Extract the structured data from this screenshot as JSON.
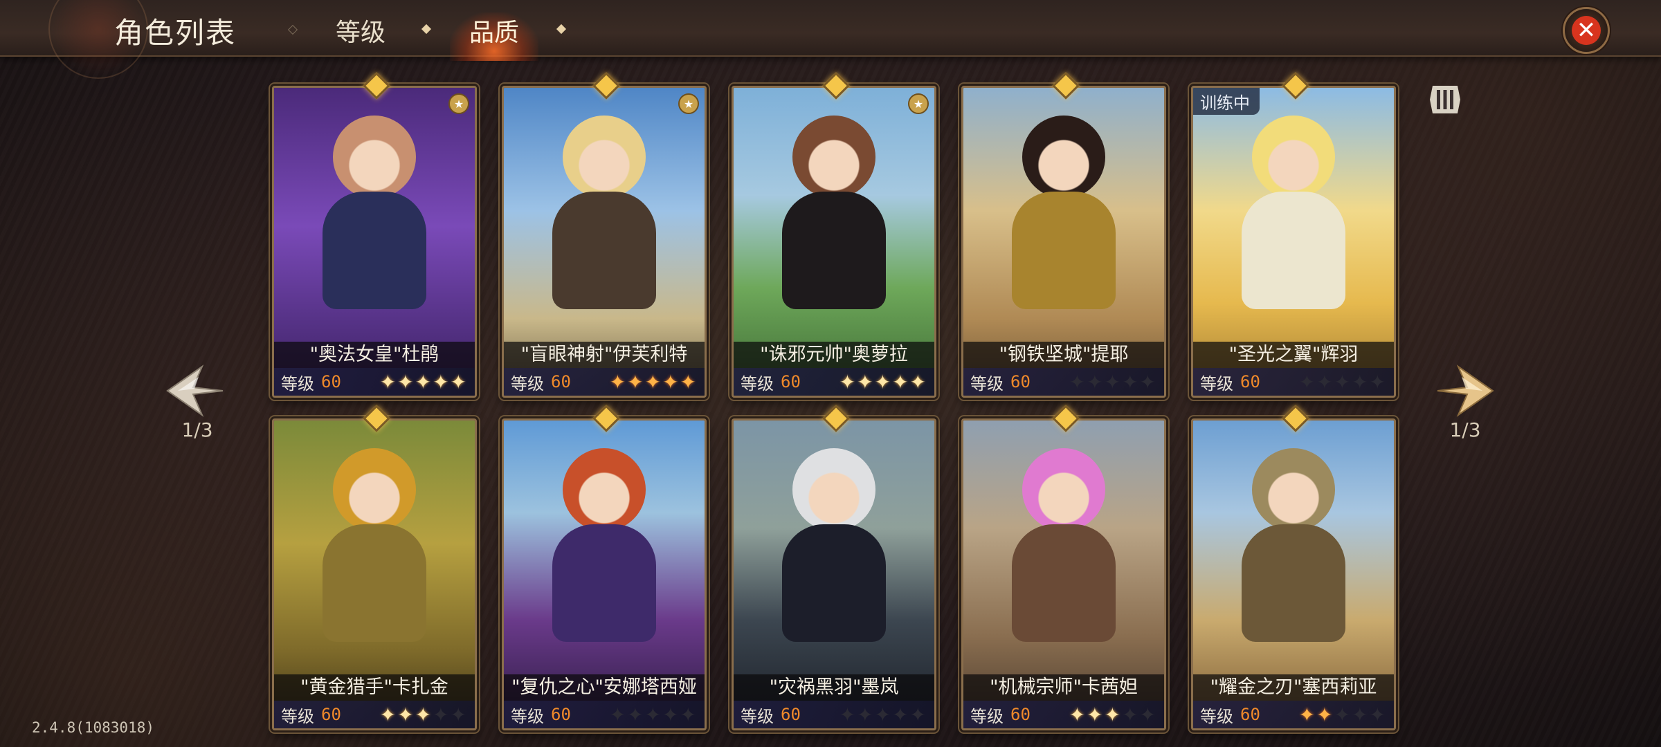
{
  "header": {
    "title": "角色列表",
    "tabs": [
      {
        "label": "等级",
        "active": false
      },
      {
        "label": "品质",
        "active": true
      }
    ],
    "close_icon": "close-icon"
  },
  "pagination": {
    "left": "1/3",
    "right": "1/3"
  },
  "level_label": "等级",
  "training_label": "训练中",
  "version": "2.4.8(1083018)",
  "colors": {
    "accent_gem": "#f5c64a",
    "level_value": "#f08a2a",
    "close_red": "#d8341e",
    "active_tab_glow": "#ff6e28"
  },
  "cards": [
    {
      "name": "\"奥法女皇\"杜鹃",
      "level": "60",
      "stars_lit": 5,
      "star_style": "on",
      "theme": "arcane",
      "badge": true
    },
    {
      "name": "\"盲眼神射\"伊芙利特",
      "level": "60",
      "stars_lit": 5,
      "star_style": "orange",
      "theme": "sky",
      "badge": true
    },
    {
      "name": "\"诛邪元帅\"奥萝拉",
      "level": "60",
      "stars_lit": 5,
      "star_style": "on",
      "theme": "meadow",
      "badge": true
    },
    {
      "name": "\"钢铁坚城\"提耶",
      "level": "60",
      "stars_lit": 0,
      "star_style": "on",
      "theme": "desert",
      "badge": false
    },
    {
      "name": "\"圣光之翼\"辉羽",
      "level": "60",
      "stars_lit": 0,
      "star_style": "on",
      "theme": "holy",
      "badge": false,
      "training": true
    },
    {
      "name": "\"黄金猎手\"卡扎金",
      "level": "60",
      "stars_lit": 3,
      "star_style": "on",
      "theme": "gold",
      "badge": false
    },
    {
      "name": "\"复仇之心\"安娜塔西娅",
      "level": "60",
      "stars_lit": 0,
      "star_style": "on",
      "theme": "violet",
      "badge": false
    },
    {
      "name": "\"灾祸黑羽\"墨岚",
      "level": "60",
      "stars_lit": 0,
      "star_style": "on",
      "theme": "dark",
      "badge": false
    },
    {
      "name": "\"机械宗师\"卡茜妲",
      "level": "60",
      "stars_lit": 3,
      "star_style": "on",
      "theme": "steam",
      "badge": false
    },
    {
      "name": "\"耀金之刃\"塞西莉亚",
      "level": "60",
      "stars_lit": 2,
      "star_style": "orange",
      "theme": "sand",
      "badge": false
    }
  ]
}
